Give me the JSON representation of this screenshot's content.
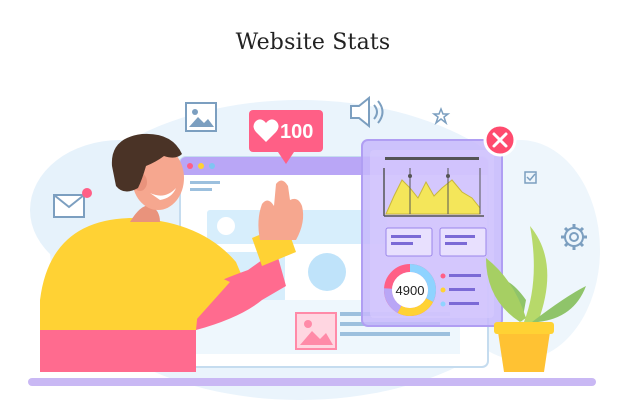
{
  "page": {
    "title": "Website Stats"
  },
  "like_badge": {
    "count": "100",
    "icon": "heart-icon"
  },
  "stats_panel": {
    "donut_value": "4900",
    "close_icon": "close-icon"
  },
  "colors": {
    "accent_purple": "#b9a6f6",
    "panel_purple": "#c7b8fb",
    "like_pink": "#ff5f86",
    "close_red": "#ff4b6e",
    "browser_blue": "#d7eefc",
    "chart_yellow": "#f4e65a",
    "shirt_yellow": "#ffd234",
    "shirt_pink": "#ff6b8f"
  },
  "icons": [
    "image-icon",
    "speaker-icon",
    "star-icon",
    "mail-icon",
    "gear-icon",
    "checkbox-icon",
    "plant-icon"
  ]
}
